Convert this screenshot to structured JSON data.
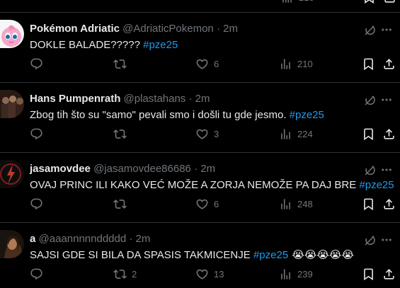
{
  "top_partial": {
    "views": "210"
  },
  "tweets": [
    {
      "name": "Pokémon Adriatic",
      "handle": "@AdriaticPokemon",
      "dot": "·",
      "time": "2m",
      "text": "DOKLE BALADE?????",
      "hashtag": "#pze25",
      "emojis": "",
      "replies": "",
      "reposts": "",
      "likes": "6",
      "views": "210",
      "avatar": "jigglypuff-avatar"
    },
    {
      "name": "Hans Pumpenrath",
      "handle": "@plastahans",
      "dot": "·",
      "time": "2m",
      "text": "Zbog tih što su \"samo\" pevali smo i došli tu gde jesmo.",
      "hashtag": "#pze25",
      "emojis": "",
      "replies": "",
      "reposts": "",
      "likes": "3",
      "views": "224",
      "avatar": "band-photo-avatar"
    },
    {
      "name": "jasamovdee",
      "handle": "@jasamovdee86686",
      "dot": "·",
      "time": "2m",
      "text": "OVAJ PRINC ILI KAKO VEĆ MOŽE A ZORJA NEMOŽE PA DAJ BRE",
      "hashtag": "#pze25",
      "emojis": "",
      "replies": "",
      "reposts": "",
      "likes": "6",
      "views": "248",
      "avatar": "lightning-logo-avatar"
    },
    {
      "name": "a",
      "handle": "@aaannnnnddddd",
      "dot": "·",
      "time": "2m",
      "text": "SAJSI GDE SI BILA DA SPASIS TAKMICENJE",
      "hashtag": "#pze25",
      "emojis": "😭😭😭😭😭",
      "replies": "",
      "reposts": "2",
      "likes": "13",
      "views": "239",
      "avatar": "dark-portrait-avatar"
    }
  ],
  "colors": {
    "background": "#000000",
    "text": "#e7e9ea",
    "muted": "#71767b",
    "hashtag": "#1d9bf0",
    "divider": "#2f3336"
  }
}
